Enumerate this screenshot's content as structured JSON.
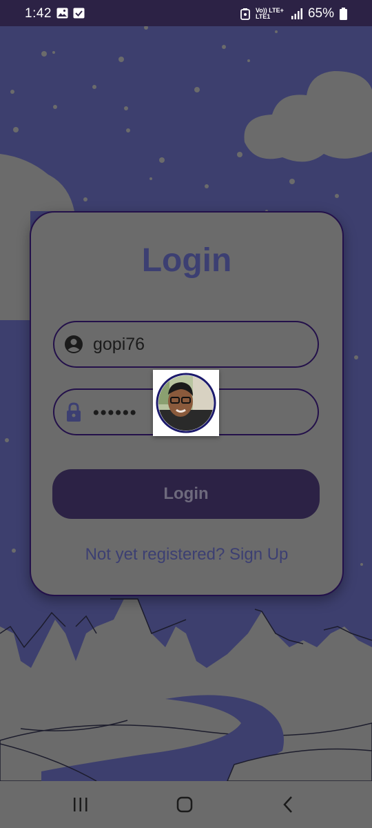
{
  "status_bar": {
    "time": "1:42",
    "network_label": "Vo)) LTE+ LTE1",
    "battery": "65%",
    "icons": [
      "gallery-icon",
      "checkbox-icon",
      "lock-app-icon",
      "signal-icon",
      "battery-icon"
    ]
  },
  "login_card": {
    "title": "Login",
    "username": {
      "value": "gopi76",
      "icon": "user-icon"
    },
    "password": {
      "value": "••••••",
      "icon": "lock-icon"
    },
    "login_button": "Login",
    "signup_link": "Not yet registered? Sign Up"
  },
  "overlay": {
    "avatar": "profile-avatar"
  },
  "nav_bar": {
    "buttons": [
      "recents-button",
      "home-button",
      "back-button"
    ]
  },
  "colors": {
    "background": "#3d3f6e",
    "card": "#6b6b6b",
    "accent_dark": "#2c2245",
    "title": "#3c3f72"
  }
}
